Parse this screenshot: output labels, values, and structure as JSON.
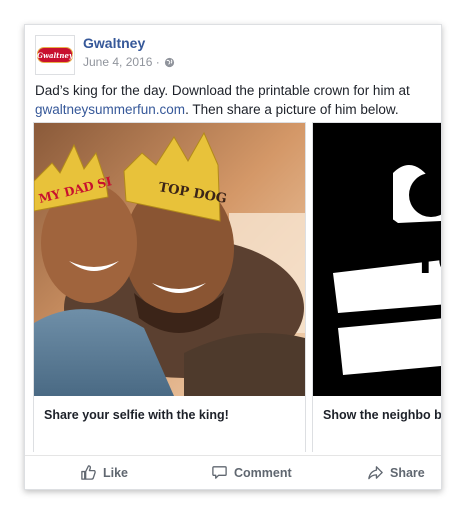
{
  "post": {
    "page_name": "Gwaltney",
    "logo_text": "Gwaltney",
    "date": "June 4, 2016 ·",
    "text_before_link": "Dad’s king for the day. Download the printable crown for him at ",
    "link": "gwaltneysummerfun.com",
    "text_after_link": ". Then share a picture of him below."
  },
  "carousel": {
    "cards": [
      {
        "caption": "Share your selfie with the king!",
        "image_texts": [
          "MY DAD SI",
          "TOP DOG"
        ]
      },
      {
        "caption": "Show the neighbo boss.",
        "image_texts": [
          "TO"
        ]
      }
    ]
  },
  "actions": {
    "like": "Like",
    "comment": "Comment",
    "share": "Share"
  },
  "colors": {
    "link": "#365899",
    "muted": "#90949c",
    "action": "#606770",
    "crown": "#e8c23a",
    "brand_red": "#c8102e"
  }
}
